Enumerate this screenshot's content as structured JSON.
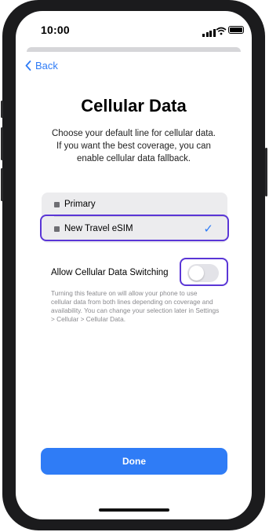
{
  "status_bar": {
    "time": "10:00"
  },
  "nav": {
    "back_label": "Back"
  },
  "page": {
    "title": "Cellular Data",
    "subtitle": "Choose your default line for cellular data. If you want the best coverage, you can enable cellular data fallback."
  },
  "lines": [
    {
      "label": "Primary",
      "selected": false
    },
    {
      "label": "New Travel eSIM",
      "selected": true
    }
  ],
  "data_switching": {
    "label": "Allow Cellular Data Switching",
    "enabled": false,
    "footnote": "Turning this feature on will allow your phone to use cellular data from both lines depending on coverage and availability. You can change your selection later in Settings > Cellular > Cellular Data."
  },
  "done_button": {
    "label": "Done"
  },
  "colors": {
    "accent": "#2f7cf6",
    "highlight": "#5a36d6"
  },
  "icons": {
    "back": "chevron-left-icon",
    "check": "checkmark-icon"
  }
}
